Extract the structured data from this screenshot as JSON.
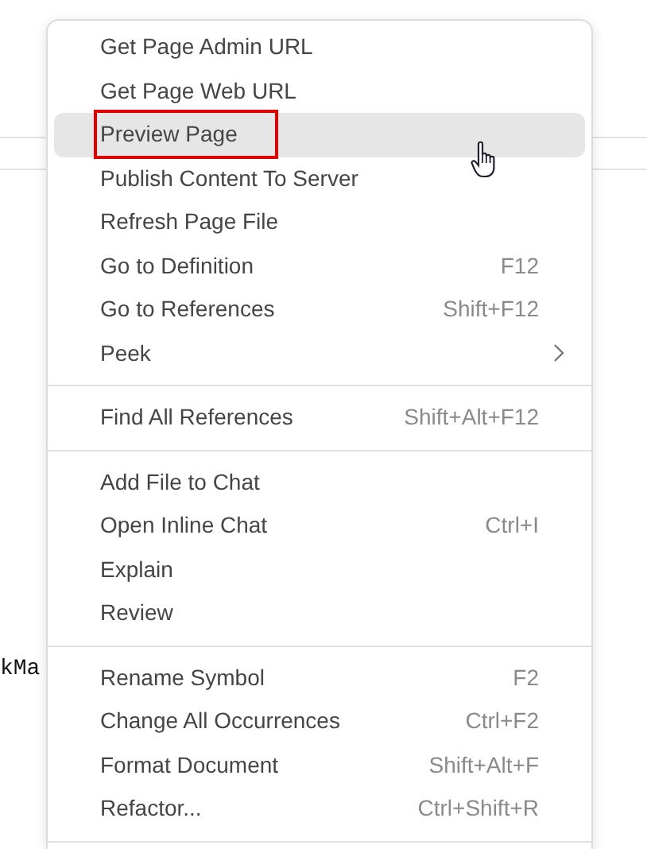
{
  "editor": {
    "code_fragment": "kMa"
  },
  "context_menu": {
    "groups": [
      {
        "items": [
          {
            "label": "Get Page Admin URL",
            "submenu": false,
            "selected": false,
            "outlined": false
          },
          {
            "label": "Get Page Web URL",
            "submenu": false,
            "selected": false,
            "outlined": false
          },
          {
            "label": "Preview Page",
            "submenu": false,
            "selected": true,
            "outlined": true
          },
          {
            "label": "Publish Content To Server",
            "submenu": false,
            "selected": false,
            "outlined": false
          },
          {
            "label": "Refresh Page File",
            "submenu": false,
            "selected": false,
            "outlined": false
          },
          {
            "label": "Go to Definition",
            "shortcut": "F12",
            "submenu": false,
            "selected": false,
            "outlined": false
          },
          {
            "label": "Go to References",
            "shortcut": "Shift+F12",
            "submenu": false,
            "selected": false,
            "outlined": false
          },
          {
            "label": "Peek",
            "submenu": true,
            "selected": false,
            "outlined": false
          }
        ]
      },
      {
        "items": [
          {
            "label": "Find All References",
            "shortcut": "Shift+Alt+F12",
            "submenu": false,
            "selected": false,
            "outlined": false
          }
        ]
      },
      {
        "items": [
          {
            "label": "Add File to Chat",
            "submenu": false,
            "selected": false,
            "outlined": false
          },
          {
            "label": "Open Inline Chat",
            "shortcut": "Ctrl+I",
            "submenu": false,
            "selected": false,
            "outlined": false
          },
          {
            "label": "Explain",
            "submenu": false,
            "selected": false,
            "outlined": false
          },
          {
            "label": "Review",
            "submenu": false,
            "selected": false,
            "outlined": false
          }
        ]
      },
      {
        "items": [
          {
            "label": "Rename Symbol",
            "shortcut": "F2",
            "submenu": false,
            "selected": false,
            "outlined": false
          },
          {
            "label": "Change All Occurrences",
            "shortcut": "Ctrl+F2",
            "submenu": false,
            "selected": false,
            "outlined": false
          },
          {
            "label": "Format Document",
            "shortcut": "Shift+Alt+F",
            "submenu": false,
            "selected": false,
            "outlined": false
          },
          {
            "label": "Refactor...",
            "shortcut": "Ctrl+Shift+R",
            "submenu": false,
            "selected": false,
            "outlined": false
          }
        ]
      }
    ]
  }
}
